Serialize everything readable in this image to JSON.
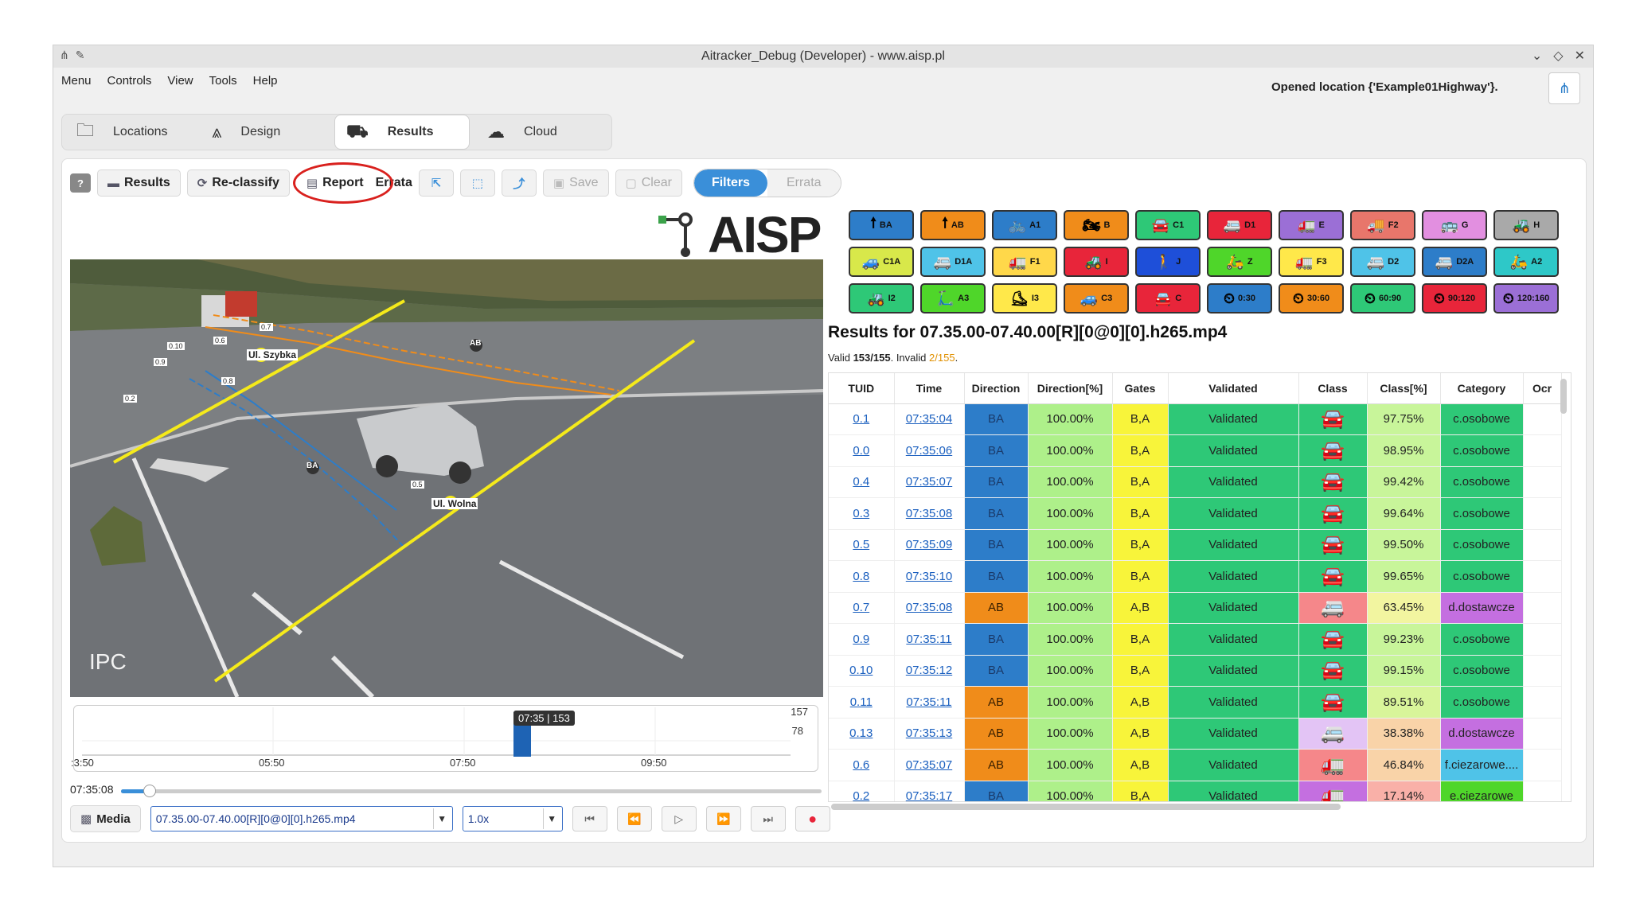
{
  "window": {
    "title": "Aitracker_Debug (Developer) - www.aisp.pl",
    "left_icons": [
      "app-icon",
      "pin-icon"
    ],
    "right_icons": [
      "chevron-down-icon",
      "diamond-icon",
      "close-icon"
    ]
  },
  "menu": [
    "Menu",
    "Controls",
    "View",
    "Tools",
    "Help"
  ],
  "status": {
    "message": "Opened location {'Example01Highway'}."
  },
  "tabs": [
    {
      "label": "Locations",
      "icon": "folder-icon",
      "active": false
    },
    {
      "label": "Design",
      "icon": "road-icon",
      "active": false
    },
    {
      "label": "Results",
      "icon": "traffic-icon",
      "active": true
    },
    {
      "label": "Cloud",
      "icon": "cloud-icon",
      "active": false
    }
  ],
  "toolbar": {
    "help": "?",
    "results": "Results",
    "reclassify": "Re-classify",
    "report": "Report",
    "errata_label": "Errata",
    "save": "Save",
    "clear": "Clear",
    "filters": "Filters",
    "errata": "Errata"
  },
  "logo": {
    "text": "AISP"
  },
  "video": {
    "osd": "IPC",
    "gate_labels": [
      "Ul. Szybka",
      "Ul. Wolna"
    ],
    "track_tags": [
      {
        "id": "0.7",
        "dir": "AB"
      },
      {
        "id": "0.6",
        "dir": "AB"
      },
      {
        "id": "0.10",
        "dir": "BA"
      },
      {
        "id": "0.9",
        "dir": "BA"
      },
      {
        "id": "0.8",
        "dir": "BA"
      },
      {
        "id": "0.2",
        "dir": "BA"
      },
      {
        "id": "0.5",
        "dir": "BA"
      }
    ],
    "direction_badges": [
      "AB",
      "BA"
    ]
  },
  "timeline": {
    "badge": "07:35 | 153",
    "y_max": "157",
    "y_mid": "78",
    "x_labels": [
      ":3:50",
      "05:50",
      "07:50",
      "09:50"
    ],
    "current_time": "07:35:08"
  },
  "player": {
    "media": "Media",
    "file": "07.35.00-07.40.00[R][0@0][0].h265.mp4",
    "speed": "1.0x"
  },
  "legend": [
    {
      "label": "BA",
      "color": "#2d7dc9",
      "icon": "arrow-up-icon"
    },
    {
      "label": "AB",
      "color": "#f08c1a",
      "icon": "arrow-up-icon"
    },
    {
      "label": "A1",
      "color": "#2d7dc9",
      "icon": "bicycle-icon"
    },
    {
      "label": "B",
      "color": "#f08c1a",
      "icon": "motorcycle-icon"
    },
    {
      "label": "C1",
      "color": "#2ec877",
      "icon": "car-icon"
    },
    {
      "label": "D1",
      "color": "#e8253a",
      "icon": "van-icon"
    },
    {
      "label": "E",
      "color": "#9b6fd6",
      "icon": "truck-icon"
    },
    {
      "label": "F2",
      "color": "#e8766b",
      "icon": "trailer-icon"
    },
    {
      "label": "G",
      "color": "#e28fe0",
      "icon": "bus-icon"
    },
    {
      "label": "H",
      "color": "#a9a9a9",
      "icon": "tractor-icon"
    },
    {
      "label": "C1A",
      "color": "#d8e84a",
      "icon": "car-trailer-icon"
    },
    {
      "label": "D1A",
      "color": "#4fc3e8",
      "icon": "van-trailer-icon"
    },
    {
      "label": "F1",
      "color": "#ffd84a",
      "icon": "truck-icon"
    },
    {
      "label": "I",
      "color": "#e8253a",
      "icon": "tractor-icon"
    },
    {
      "label": "J",
      "color": "#1e4fd9",
      "icon": "pedestrian-icon"
    },
    {
      "label": "Z",
      "color": "#4fd62a",
      "icon": "scooter-icon"
    },
    {
      "label": "F3",
      "color": "#ffe84a",
      "icon": "long-truck-icon"
    },
    {
      "label": "D2",
      "color": "#4fc3e8",
      "icon": "van-icon"
    },
    {
      "label": "D2A",
      "color": "#2d7dc9",
      "icon": "van-trailer-icon"
    },
    {
      "label": "A2",
      "color": "#2ec8c8",
      "icon": "scooter-icon"
    },
    {
      "label": "I2",
      "color": "#2ec877",
      "icon": "mower-icon"
    },
    {
      "label": "A3",
      "color": "#4fd62a",
      "icon": "kickscooter-icon"
    },
    {
      "label": "I3",
      "color": "#ffe84a",
      "icon": "skate-icon"
    },
    {
      "label": "C3",
      "color": "#f08c1a",
      "icon": "suv-icon"
    },
    {
      "label": "C",
      "color": "#e8253a",
      "icon": "car-icon"
    },
    {
      "label": "0:30",
      "color": "#2d7dc9",
      "icon": "speed-icon"
    },
    {
      "label": "30:60",
      "color": "#f08c1a",
      "icon": "speed-icon"
    },
    {
      "label": "60:90",
      "color": "#2ec877",
      "icon": "speed-icon"
    },
    {
      "label": "90:120",
      "color": "#e8253a",
      "icon": "speed-icon"
    },
    {
      "label": "120:160",
      "color": "#9b6fd6",
      "icon": "speed-icon"
    }
  ],
  "results": {
    "title": "Results for 07.35.00-07.40.00[R][0@0][0].h265.mp4",
    "valid_prefix": "Valid",
    "valid": "153/155",
    "invalid_prefix": "Invalid",
    "invalid": "2/155",
    "columns": [
      "TUID",
      "Time",
      "Direction",
      "Direction[%]",
      "Gates",
      "Validated",
      "Class",
      "Class[%]",
      "Category",
      "Ocr"
    ],
    "rows": [
      {
        "tuid": "0.1",
        "time": "07:35:04",
        "dir": "BA",
        "dirpct": "100.00%",
        "gates": "B,A",
        "validated": "Validated",
        "cls": "car-icon",
        "clspct": "97.75%",
        "category": "c.osobowe",
        "catcolor": "#2ec877",
        "clscolor": "#2ec877",
        "pctcolor": "#c8f59a"
      },
      {
        "tuid": "0.0",
        "time": "07:35:06",
        "dir": "BA",
        "dirpct": "100.00%",
        "gates": "B,A",
        "validated": "Validated",
        "cls": "car-icon",
        "clspct": "98.95%",
        "category": "c.osobowe",
        "catcolor": "#2ec877",
        "clscolor": "#2ec877",
        "pctcolor": "#c8f59a"
      },
      {
        "tuid": "0.4",
        "time": "07:35:07",
        "dir": "BA",
        "dirpct": "100.00%",
        "gates": "B,A",
        "validated": "Validated",
        "cls": "car-icon",
        "clspct": "99.42%",
        "category": "c.osobowe",
        "catcolor": "#2ec877",
        "clscolor": "#2ec877",
        "pctcolor": "#c8f59a"
      },
      {
        "tuid": "0.3",
        "time": "07:35:08",
        "dir": "BA",
        "dirpct": "100.00%",
        "gates": "B,A",
        "validated": "Validated",
        "cls": "car-icon",
        "clspct": "99.64%",
        "category": "c.osobowe",
        "catcolor": "#2ec877",
        "clscolor": "#2ec877",
        "pctcolor": "#c8f59a"
      },
      {
        "tuid": "0.5",
        "time": "07:35:09",
        "dir": "BA",
        "dirpct": "100.00%",
        "gates": "B,A",
        "validated": "Validated",
        "cls": "car-icon",
        "clspct": "99.50%",
        "category": "c.osobowe",
        "catcolor": "#2ec877",
        "clscolor": "#2ec877",
        "pctcolor": "#c8f59a"
      },
      {
        "tuid": "0.8",
        "time": "07:35:10",
        "dir": "BA",
        "dirpct": "100.00%",
        "gates": "B,A",
        "validated": "Validated",
        "cls": "car-icon",
        "clspct": "99.65%",
        "category": "c.osobowe",
        "catcolor": "#2ec877",
        "clscolor": "#2ec877",
        "pctcolor": "#c8f59a"
      },
      {
        "tuid": "0.7",
        "time": "07:35:08",
        "dir": "AB",
        "dirpct": "100.00%",
        "gates": "A,B",
        "validated": "Validated",
        "cls": "van-icon",
        "clspct": "63.45%",
        "category": "d.dostawcze",
        "catcolor": "#c46fe0",
        "clscolor": "#f5878a",
        "pctcolor": "#f2f5a0"
      },
      {
        "tuid": "0.9",
        "time": "07:35:11",
        "dir": "BA",
        "dirpct": "100.00%",
        "gates": "B,A",
        "validated": "Validated",
        "cls": "car-icon",
        "clspct": "99.23%",
        "category": "c.osobowe",
        "catcolor": "#2ec877",
        "clscolor": "#2ec877",
        "pctcolor": "#c8f59a"
      },
      {
        "tuid": "0.10",
        "time": "07:35:12",
        "dir": "BA",
        "dirpct": "100.00%",
        "gates": "B,A",
        "validated": "Validated",
        "cls": "car-icon",
        "clspct": "99.15%",
        "category": "c.osobowe",
        "catcolor": "#2ec877",
        "clscolor": "#2ec877",
        "pctcolor": "#c8f59a"
      },
      {
        "tuid": "0.11",
        "time": "07:35:11",
        "dir": "AB",
        "dirpct": "100.00%",
        "gates": "A,B",
        "validated": "Validated",
        "cls": "car-icon",
        "clspct": "89.51%",
        "category": "c.osobowe",
        "catcolor": "#2ec877",
        "clscolor": "#2ec877",
        "pctcolor": "#d8f59a"
      },
      {
        "tuid": "0.13",
        "time": "07:35:13",
        "dir": "AB",
        "dirpct": "100.00%",
        "gates": "A,B",
        "validated": "Validated",
        "cls": "van-icon",
        "clspct": "38.38%",
        "category": "d.dostawcze",
        "catcolor": "#c46fe0",
        "clscolor": "#e3c4f5",
        "pctcolor": "#f9d3a8"
      },
      {
        "tuid": "0.6",
        "time": "07:35:07",
        "dir": "AB",
        "dirpct": "100.00%",
        "gates": "A,B",
        "validated": "Validated",
        "cls": "truck-icon",
        "clspct": "46.84%",
        "category": "f.ciezarowe....",
        "catcolor": "#4fc3e8",
        "clscolor": "#f5878a",
        "pctcolor": "#f9d3a8"
      },
      {
        "tuid": "0.2",
        "time": "07:35:17",
        "dir": "BA",
        "dirpct": "100.00%",
        "gates": "B,A",
        "validated": "Validated",
        "cls": "truck-icon",
        "clspct": "17.14%",
        "category": "e.ciezarowe",
        "catcolor": "#4fd62a",
        "clscolor": "#c46fe0",
        "pctcolor": "#f9b0a8"
      }
    ]
  }
}
